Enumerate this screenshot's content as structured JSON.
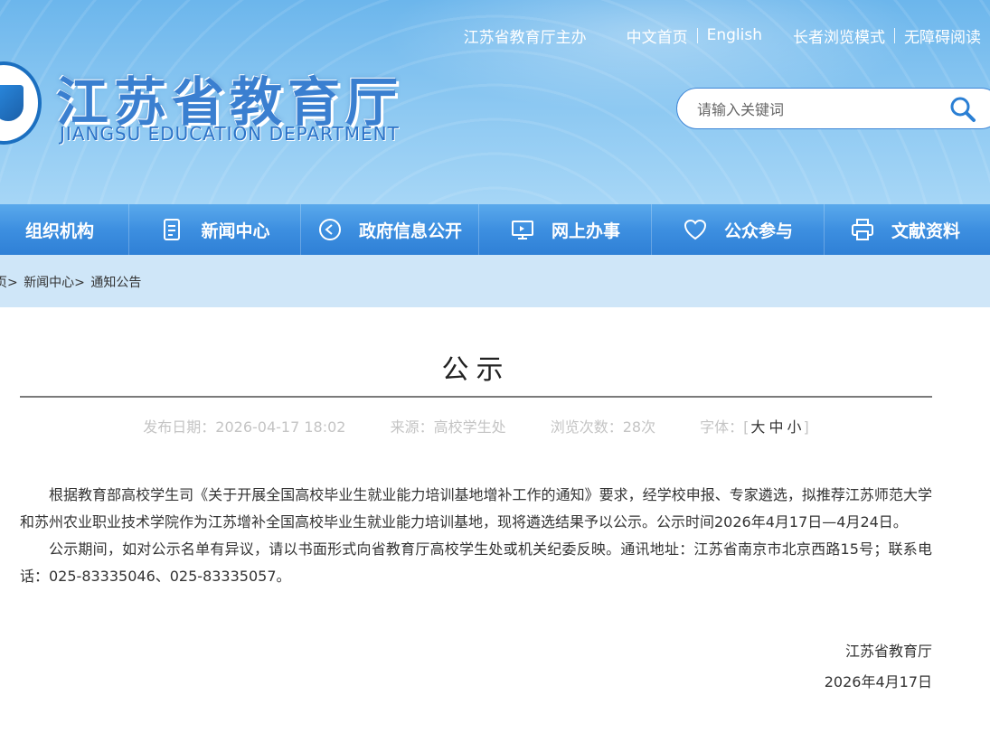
{
  "header": {
    "sponsor": "江苏省教育厅主办",
    "links": [
      "中文首页",
      "English",
      "长者浏览模式",
      "无障碍阅读"
    ],
    "logo_cn": "江苏省教育厅",
    "logo_en": "JIANGSU EDUCATION DEPARTMENT"
  },
  "search": {
    "placeholder": "请输入关键词",
    "icon": "search-icon"
  },
  "nav": [
    {
      "label": "组织机构",
      "icon": "organization-icon"
    },
    {
      "label": "新闻中心",
      "icon": "document-icon"
    },
    {
      "label": "政府信息公开",
      "icon": "play-circle-icon"
    },
    {
      "label": "网上办事",
      "icon": "monitor-icon"
    },
    {
      "label": "公众参与",
      "icon": "heart-icon"
    },
    {
      "label": "文献资料",
      "icon": "printer-icon"
    }
  ],
  "breadcrumb": [
    "页>",
    "新闻中心>",
    "通知公告"
  ],
  "article": {
    "title": "公示",
    "meta": {
      "publish_label": "发布日期：",
      "publish_date": "2026-04-17 18:02",
      "source_label": "来源：",
      "source": "高校学生处",
      "views_label": "浏览次数：",
      "views": "28次",
      "font_label": "字体：[",
      "font_large": "大",
      "font_medium": "中",
      "font_small": "小",
      "font_close": "]"
    },
    "paragraphs": [
      "根据教育部高校学生司《关于开展全国高校毕业生就业能力培训基地增补工作的通知》要求，经学校申报、专家遴选，拟推荐江苏师范大学和苏州农业职业技术学院作为江苏增补全国高校毕业生就业能力培训基地，现将遴选结果予以公示。公示时间2026年4月17日—4月24日。",
      "公示期间，如对公示名单有异议，请以书面形式向省教育厅高校学生处或机关纪委反映。通讯地址：江苏省南京市北京西路15号；联系电话：025-83335046、025-83335057。"
    ],
    "signature_org": "江苏省教育厅",
    "signature_date": "2026年4月17日"
  },
  "colors": {
    "nav_blue": "#3d8fe0",
    "breadcrumb_bg": "#cfe6f8",
    "logo_blue": "#3a7fd0"
  }
}
